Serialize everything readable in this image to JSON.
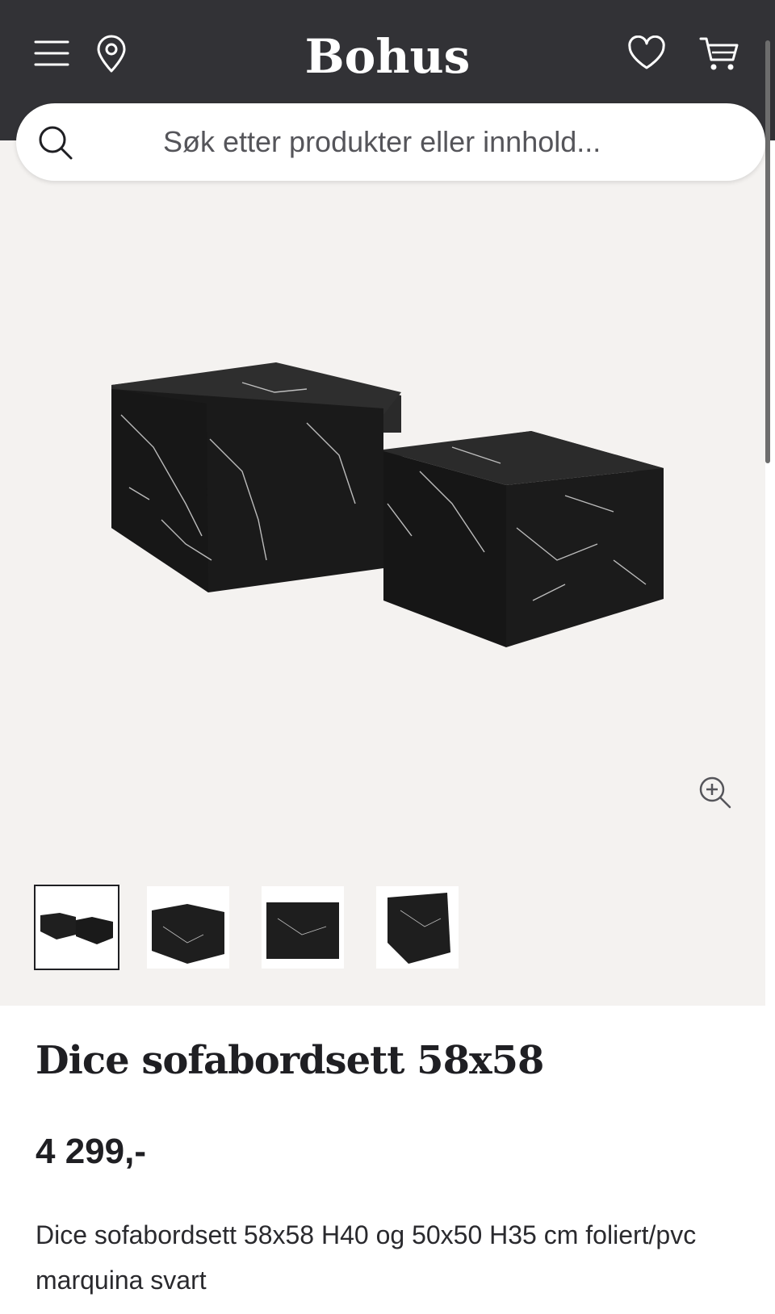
{
  "header": {
    "logo": "Bohus",
    "background": "#323236",
    "icons": [
      "menu-icon",
      "location-pin-icon",
      "heart-icon",
      "cart-icon"
    ]
  },
  "search": {
    "placeholder": "Søk etter produkter eller innhold..."
  },
  "gallery": {
    "background": "#f4f2f0",
    "thumbnail_count": 4,
    "active_thumbnail": 1
  },
  "product": {
    "title": "Dice sofabordsett 58x58",
    "price": "4 299,-",
    "description": "Dice sofabordsett 58x58 H40 og 50x50 H35 cm foliert/pvc marquina svart"
  }
}
